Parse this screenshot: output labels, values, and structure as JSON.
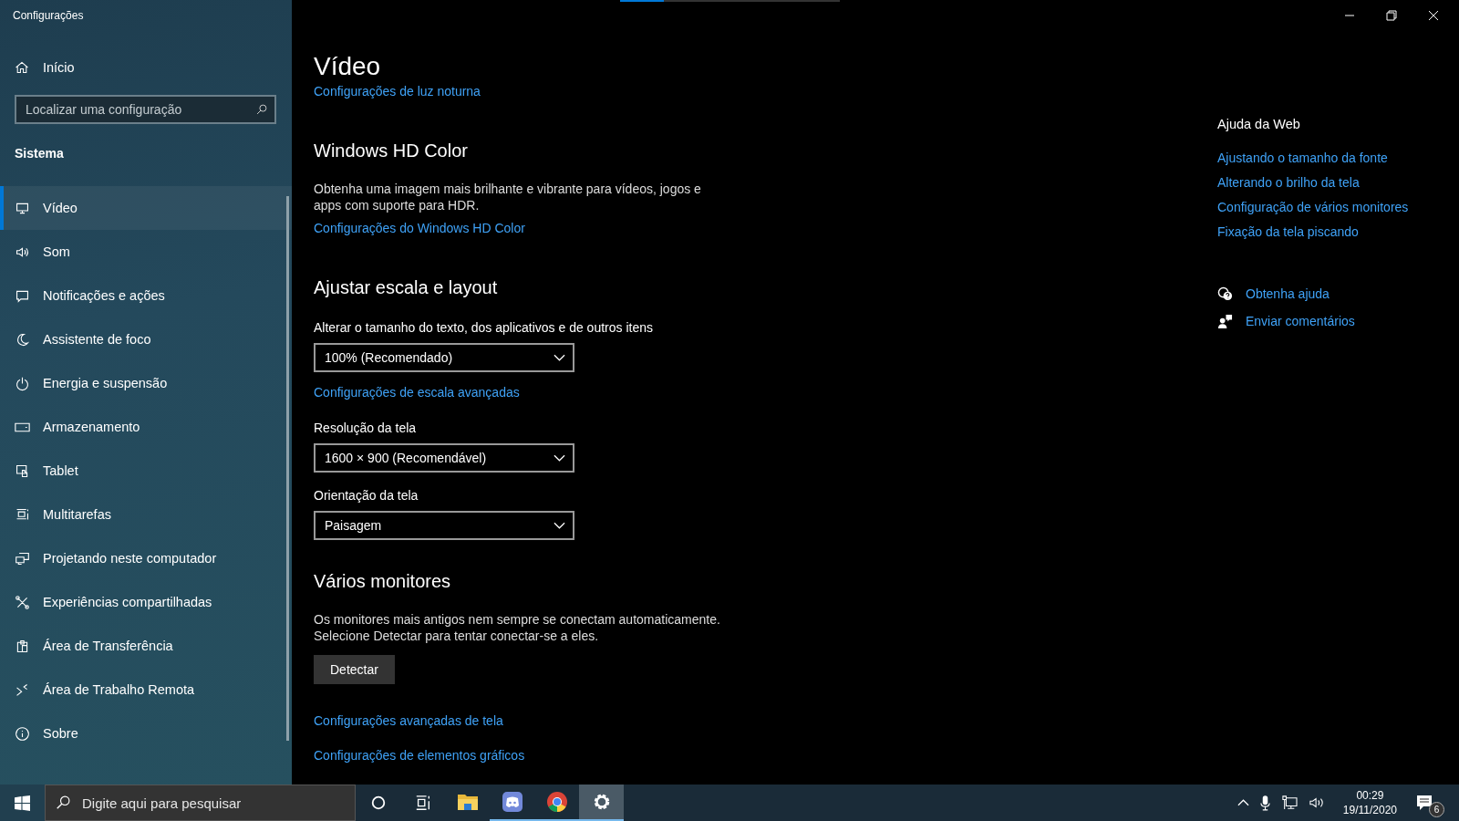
{
  "window": {
    "title": "Configurações"
  },
  "loading": {
    "level": 0.2
  },
  "sidebar": {
    "home": "Início",
    "search": {
      "placeholder": "Localizar uma configuração"
    },
    "section": "Sistema",
    "items": [
      {
        "label": "Vídeo",
        "selected": true
      },
      {
        "label": "Som",
        "selected": false
      },
      {
        "label": "Notificações e ações",
        "selected": false
      },
      {
        "label": "Assistente de foco",
        "selected": false
      },
      {
        "label": "Energia e suspensão",
        "selected": false
      },
      {
        "label": "Armazenamento",
        "selected": false
      },
      {
        "label": "Tablet",
        "selected": false
      },
      {
        "label": "Multitarefas",
        "selected": false
      },
      {
        "label": "Projetando neste computador",
        "selected": false
      },
      {
        "label": "Experiências compartilhadas",
        "selected": false
      },
      {
        "label": "Área de Transferência",
        "selected": false
      },
      {
        "label": "Área de Trabalho Remota",
        "selected": false
      },
      {
        "label": "Sobre",
        "selected": false
      }
    ]
  },
  "content": [
    {
      "kind": "title",
      "text": "Vídeo"
    },
    {
      "kind": "link",
      "text": "Configurações de luz noturna"
    },
    {
      "kind": "heading",
      "text": "Windows HD Color"
    },
    {
      "kind": "text",
      "text": "Obtenha uma imagem mais brilhante e vibrante para vídeos, jogos e apps com suporte para HDR."
    },
    {
      "kind": "link",
      "text": "Configurações do Windows HD Color"
    },
    {
      "kind": "heading",
      "text": "Ajustar escala e layout"
    },
    {
      "kind": "label",
      "text": "Alterar o tamanho do texto, dos aplicativos e de outros itens"
    },
    {
      "kind": "dropdown",
      "text": "100% (Recomendado)"
    },
    {
      "kind": "link",
      "text": "Configurações de escala avançadas"
    },
    {
      "kind": "label",
      "text": "Resolução da tela"
    },
    {
      "kind": "dropdown",
      "text": "1600 × 900 (Recomendável)"
    },
    {
      "kind": "label",
      "text": "Orientação da tela"
    },
    {
      "kind": "dropdown",
      "text": "Paisagem"
    },
    {
      "kind": "heading",
      "text": "Vários monitores"
    },
    {
      "kind": "text",
      "text": "Os monitores mais antigos nem sempre se conectam automaticamente. Selecione Detectar para tentar conectar-se a eles."
    },
    {
      "kind": "button",
      "text": "Detectar"
    },
    {
      "kind": "link",
      "text": "Configurações avançadas de tela"
    },
    {
      "kind": "link",
      "text": "Configurações de elementos gráficos"
    }
  ],
  "help": {
    "title": "Ajuda da Web",
    "links": [
      "Ajustando o tamanho da fonte",
      "Alterando o brilho da tela",
      "Configuração de vários monitores",
      "Fixação da tela piscando"
    ],
    "actions": [
      "Obtenha ajuda",
      "Enviar comentários"
    ]
  },
  "taskbar": {
    "search": {
      "placeholder": "Digite aqui para pesquisar"
    },
    "apps": [
      {
        "running": false,
        "active": false
      },
      {
        "running": true,
        "active": false
      },
      {
        "running": true,
        "active": false
      },
      {
        "running": true,
        "active": true
      }
    ],
    "time": "00:29",
    "date": "19/11/2020",
    "notifications": "6"
  }
}
